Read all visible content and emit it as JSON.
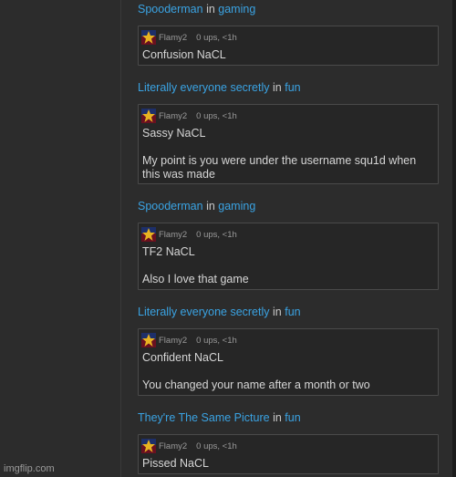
{
  "watermark": "imgflip.com",
  "colors": {
    "background": "#2c2c2c",
    "link": "#3aa3e3",
    "box": "#262626",
    "border": "#4a4a4a"
  },
  "entries": [
    {
      "title": "Spooderman",
      "in_word": "in",
      "stream": "gaming",
      "user": "Flamy2",
      "stats": "0 ups, <1h",
      "lines": [
        "Confusion NaCL"
      ]
    },
    {
      "title": "Literally everyone secretly",
      "in_word": "in",
      "stream": "fun",
      "user": "Flamy2",
      "stats": "0 ups, <1h",
      "lines": [
        "Sassy NaCL",
        "My point is you were under the username squ1d when this was made"
      ]
    },
    {
      "title": "Spooderman",
      "in_word": "in",
      "stream": "gaming",
      "user": "Flamy2",
      "stats": "0 ups, <1h",
      "lines": [
        "TF2 NaCL",
        "Also I love that game"
      ]
    },
    {
      "title": "Literally everyone secretly",
      "in_word": "in",
      "stream": "fun",
      "user": "Flamy2",
      "stats": "0 ups, <1h",
      "lines": [
        "Confident NaCL",
        "You changed your name after a month or two"
      ]
    },
    {
      "title": "They're The Same Picture",
      "in_word": "in",
      "stream": "fun",
      "user": "Flamy2",
      "stats": "0 ups, <1h",
      "lines": [
        "Pissed NaCL"
      ]
    }
  ]
}
